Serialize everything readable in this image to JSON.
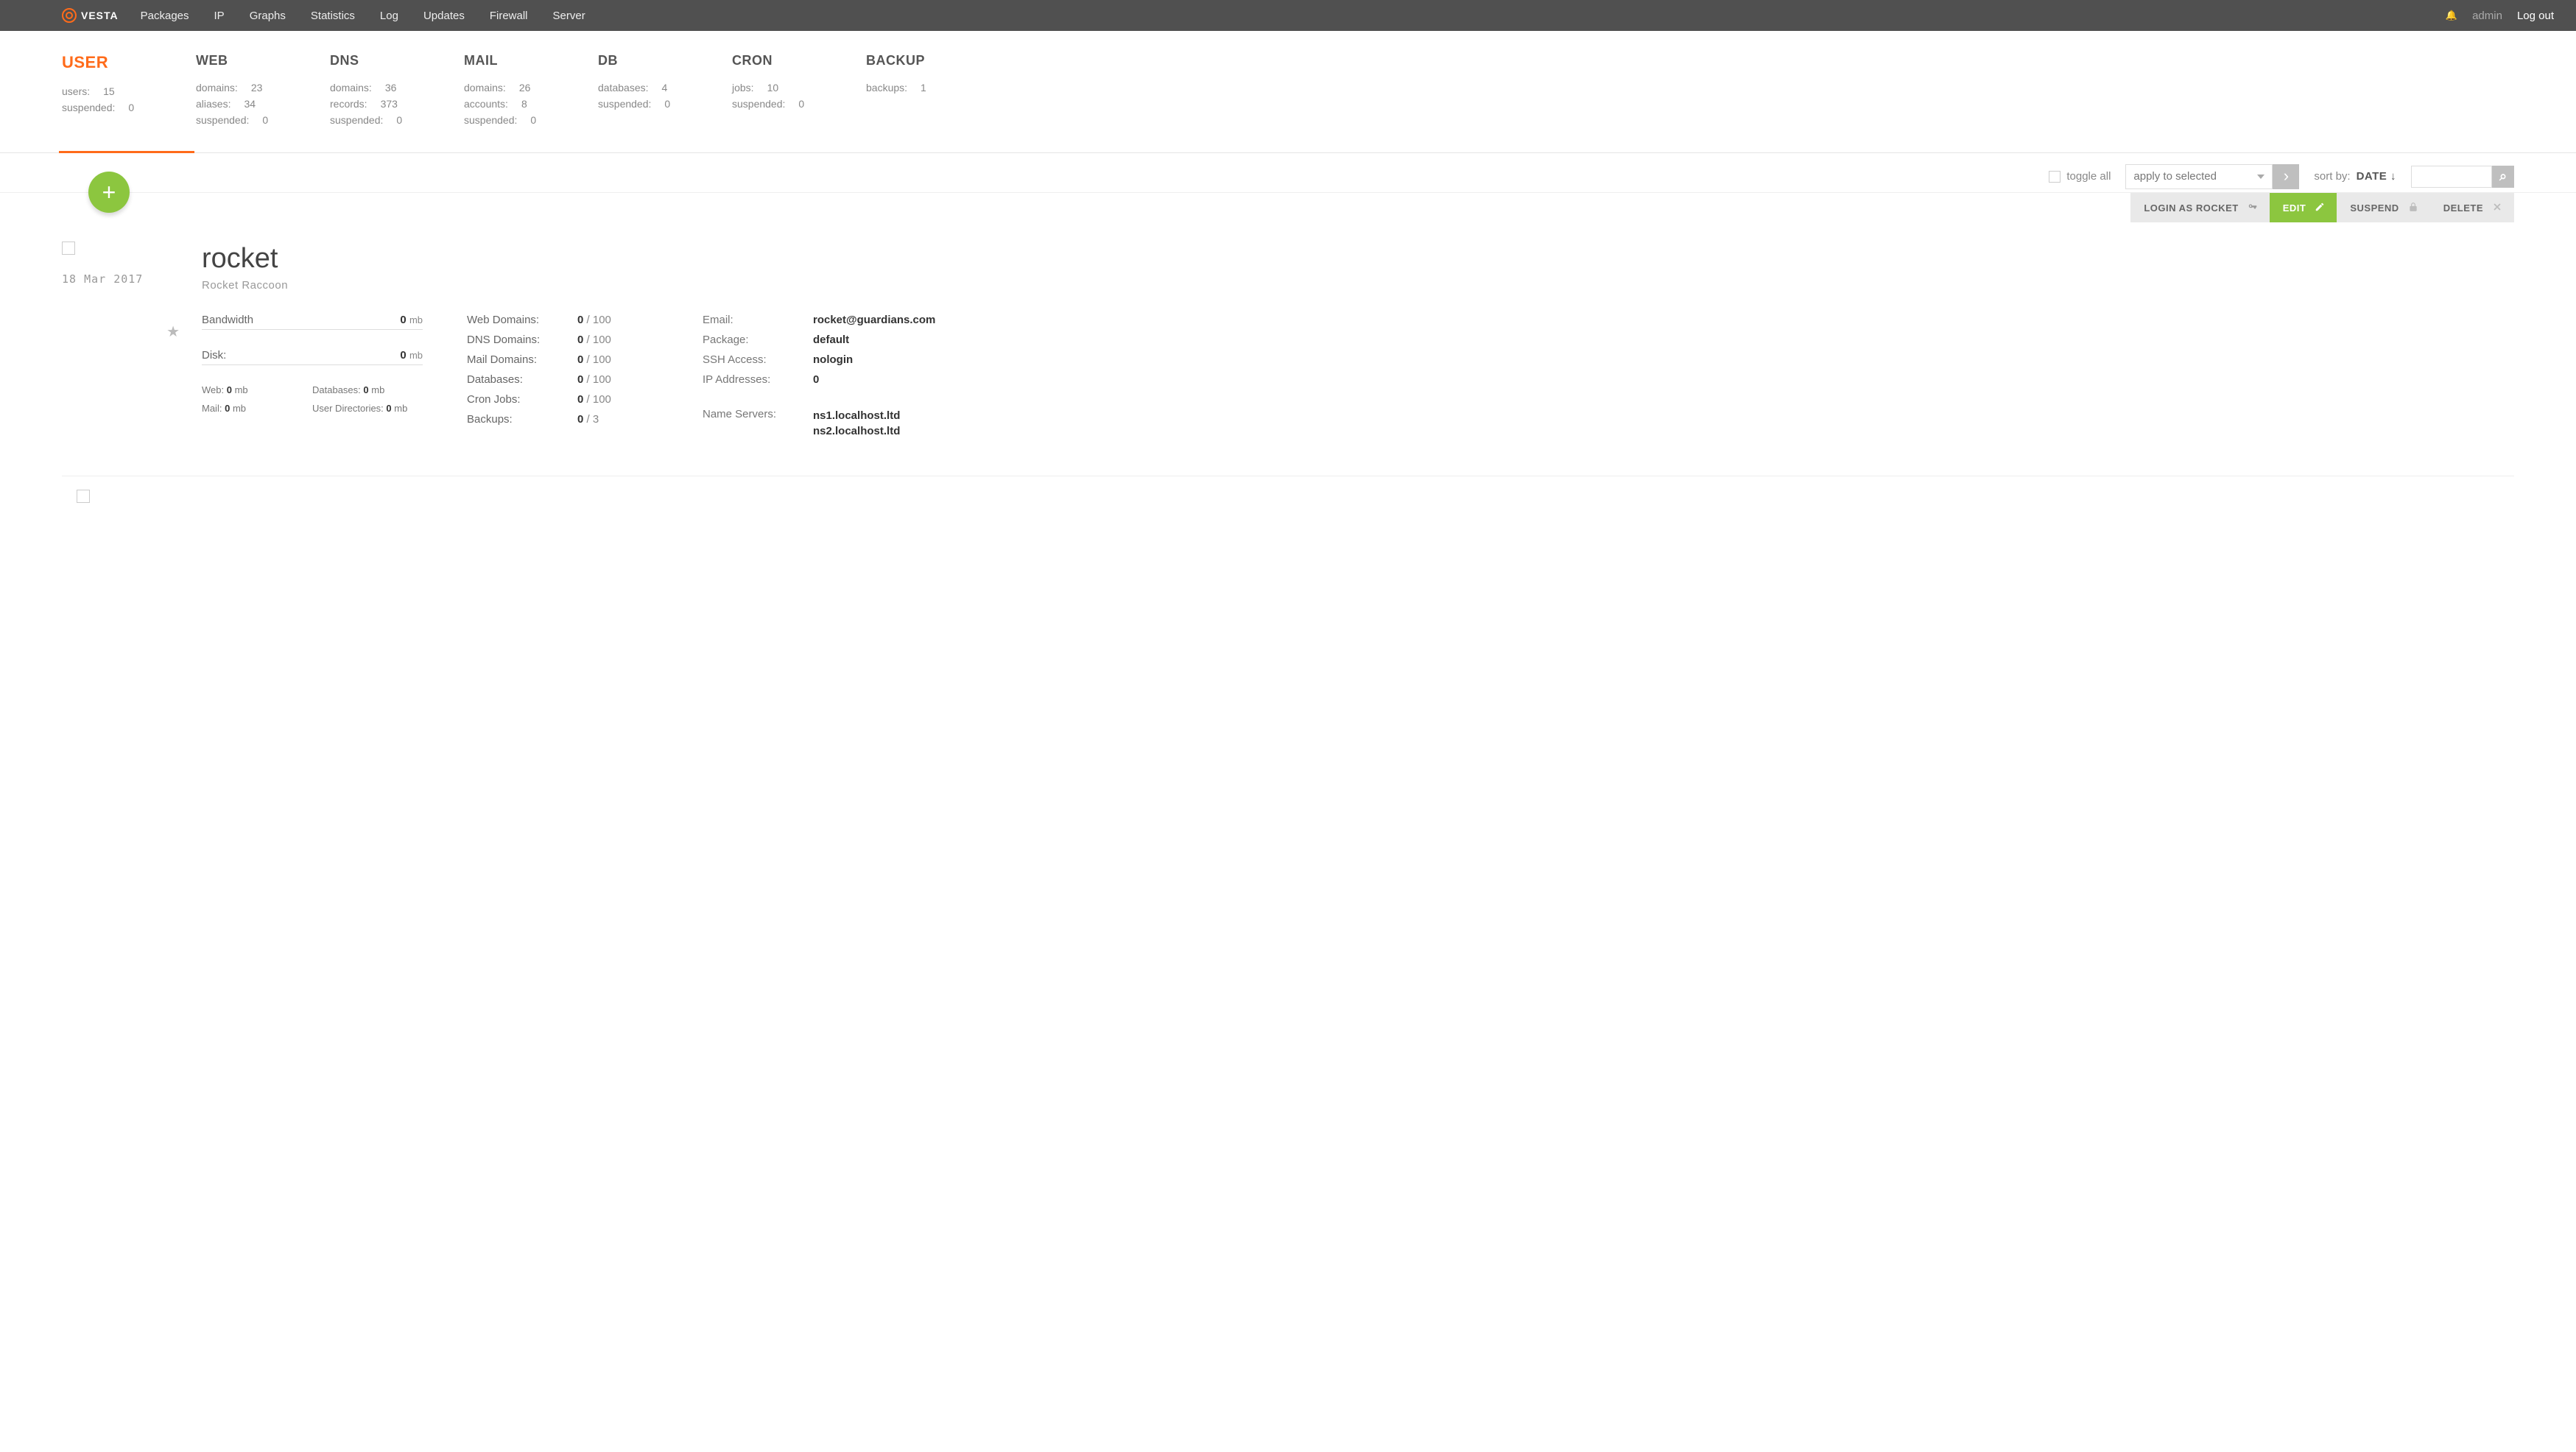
{
  "topnav": {
    "brand": "VESTA",
    "items": [
      "Packages",
      "IP",
      "Graphs",
      "Statistics",
      "Log",
      "Updates",
      "Firewall",
      "Server"
    ],
    "admin_label": "admin",
    "logout_label": "Log out"
  },
  "stats": {
    "user": {
      "title": "USER",
      "lines": [
        {
          "label": "users:",
          "value": "15"
        },
        {
          "label": "suspended:",
          "value": "0"
        }
      ]
    },
    "web": {
      "title": "WEB",
      "lines": [
        {
          "label": "domains:",
          "value": "23"
        },
        {
          "label": "aliases:",
          "value": "34"
        },
        {
          "label": "suspended:",
          "value": "0"
        }
      ]
    },
    "dns": {
      "title": "DNS",
      "lines": [
        {
          "label": "domains:",
          "value": "36"
        },
        {
          "label": "records:",
          "value": "373"
        },
        {
          "label": "suspended:",
          "value": "0"
        }
      ]
    },
    "mail": {
      "title": "MAIL",
      "lines": [
        {
          "label": "domains:",
          "value": "26"
        },
        {
          "label": "accounts:",
          "value": "8"
        },
        {
          "label": "suspended:",
          "value": "0"
        }
      ]
    },
    "db": {
      "title": "DB",
      "lines": [
        {
          "label": "databases:",
          "value": "4"
        },
        {
          "label": "suspended:",
          "value": "0"
        }
      ]
    },
    "cron": {
      "title": "CRON",
      "lines": [
        {
          "label": "jobs:",
          "value": "10"
        },
        {
          "label": "suspended:",
          "value": "0"
        }
      ]
    },
    "backup": {
      "title": "BACKUP",
      "lines": [
        {
          "label": "backups:",
          "value": "1"
        }
      ]
    }
  },
  "toolbar": {
    "toggle_label": "toggle all",
    "apply_label": "apply to selected",
    "sortby_label": "sort by:",
    "sortby_value": "DATE"
  },
  "actionbar": {
    "login_as": "LOGIN AS ROCKET",
    "edit": "EDIT",
    "suspend": "SUSPEND",
    "delete": "DELETE"
  },
  "user_entry": {
    "date": "18 Mar 2017",
    "username": "rocket",
    "fullname": "Rocket Raccoon",
    "bandwidth": {
      "label": "Bandwidth",
      "value": "0",
      "unit": "mb"
    },
    "disk": {
      "label": "Disk:",
      "value": "0",
      "unit": "mb"
    },
    "disk_sub": {
      "web": {
        "label": "Web:",
        "value": "0",
        "unit": "mb"
      },
      "databases": {
        "label": "Databases:",
        "value": "0",
        "unit": "mb"
      },
      "mail": {
        "label": "Mail:",
        "value": "0",
        "unit": "mb"
      },
      "userdirs": {
        "label": "User Directories:",
        "value": "0",
        "unit": "mb"
      }
    },
    "limits": [
      {
        "label": "Web Domains:",
        "value": "0",
        "limit": "100"
      },
      {
        "label": "DNS Domains:",
        "value": "0",
        "limit": "100"
      },
      {
        "label": "Mail Domains:",
        "value": "0",
        "limit": "100"
      },
      {
        "label": "Databases:",
        "value": "0",
        "limit": "100"
      },
      {
        "label": "Cron Jobs:",
        "value": "0",
        "limit": "100"
      },
      {
        "label": "Backups:",
        "value": "0",
        "limit": "3"
      }
    ],
    "info": {
      "email": {
        "label": "Email:",
        "value": "rocket@guardians.com"
      },
      "package": {
        "label": "Package:",
        "value": "default"
      },
      "ssh": {
        "label": "SSH Access:",
        "value": "nologin"
      },
      "ips": {
        "label": "IP Addresses:",
        "value": "0"
      },
      "ns_label": "Name Servers:",
      "ns": [
        "ns1.localhost.ltd",
        "ns2.localhost.ltd"
      ]
    }
  }
}
